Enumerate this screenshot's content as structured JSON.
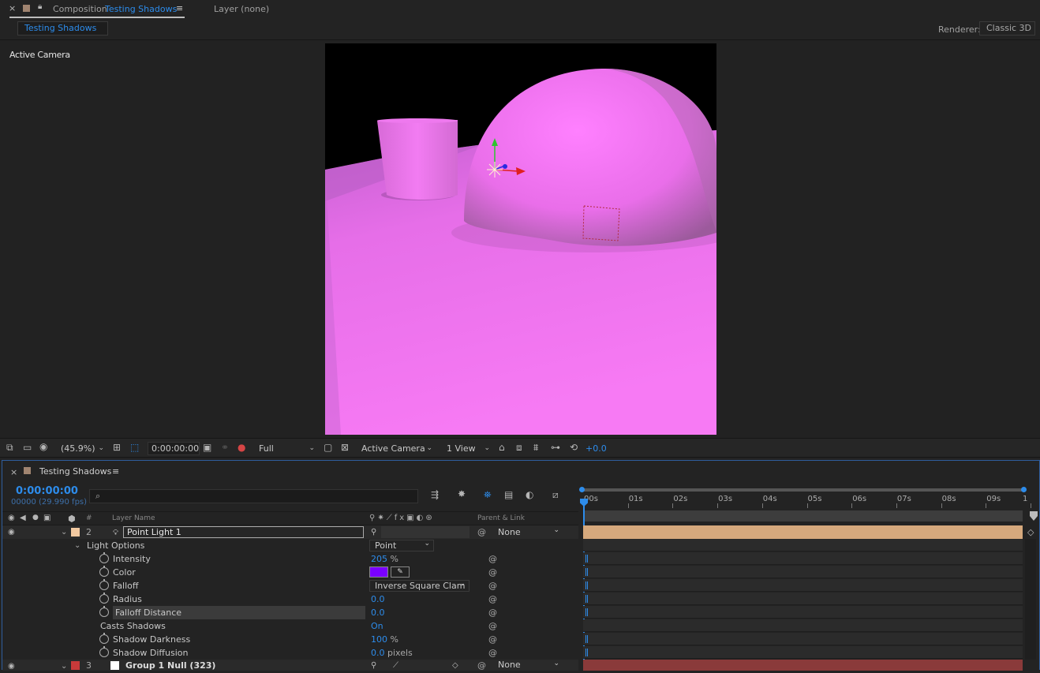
{
  "comp_panel": {
    "close": "×",
    "prefix": "Composition",
    "name": "Testing Shadows",
    "menu": "≡",
    "layer_tab": "Layer (none)",
    "subtab": "Testing Shadows",
    "renderer_label": "Renderer:",
    "renderer_value": "Classic 3D"
  },
  "viewer": {
    "view_label": "Active Camera"
  },
  "viewer_toolbar": {
    "zoom": "(45.9%)",
    "timecode": "0:00:00:00",
    "resolution": "Full",
    "view": "Active Camera",
    "layout": "1 View",
    "exposure": "+0.0"
  },
  "timeline": {
    "tab_name": "Testing Shadows",
    "menu": "≡",
    "close": "×",
    "timecode": "0:00:00:00",
    "frame_info": "00000 (29.990 fps)",
    "search_placeholder": "",
    "header": {
      "num": "#",
      "layer_name": "Layer Name",
      "parent": "Parent & Link"
    },
    "ruler": [
      "00s",
      "01s",
      "02s",
      "03s",
      "04s",
      "05s",
      "06s",
      "07s",
      "08s",
      "09s",
      "1"
    ],
    "layer2": {
      "num": "2",
      "name": "Point Light 1",
      "parent": "None",
      "label_color": "#f2c9a0"
    },
    "light_options": {
      "label": "Light Options",
      "type": "Point"
    },
    "props": [
      {
        "name": "Intensity",
        "value": "205",
        "unit": "%"
      },
      {
        "name": "Color",
        "value": "",
        "unit": ""
      },
      {
        "name": "Falloff",
        "value": "Inverse Square Clam",
        "unit": ""
      },
      {
        "name": "Radius",
        "value": "0.0",
        "unit": ""
      },
      {
        "name": "Falloff Distance",
        "value": "0.0",
        "unit": ""
      },
      {
        "name": "Casts Shadows",
        "value": "On",
        "unit": ""
      },
      {
        "name": "Shadow Darkness",
        "value": "100",
        "unit": "%"
      },
      {
        "name": "Shadow Diffusion",
        "value": "0.0",
        "unit": "pixels"
      }
    ],
    "light_color": "#7a00ff",
    "layer3": {
      "num": "3",
      "name": "Group 1 Null (323)",
      "parent": "None",
      "label_color": "#c83a3a"
    }
  }
}
